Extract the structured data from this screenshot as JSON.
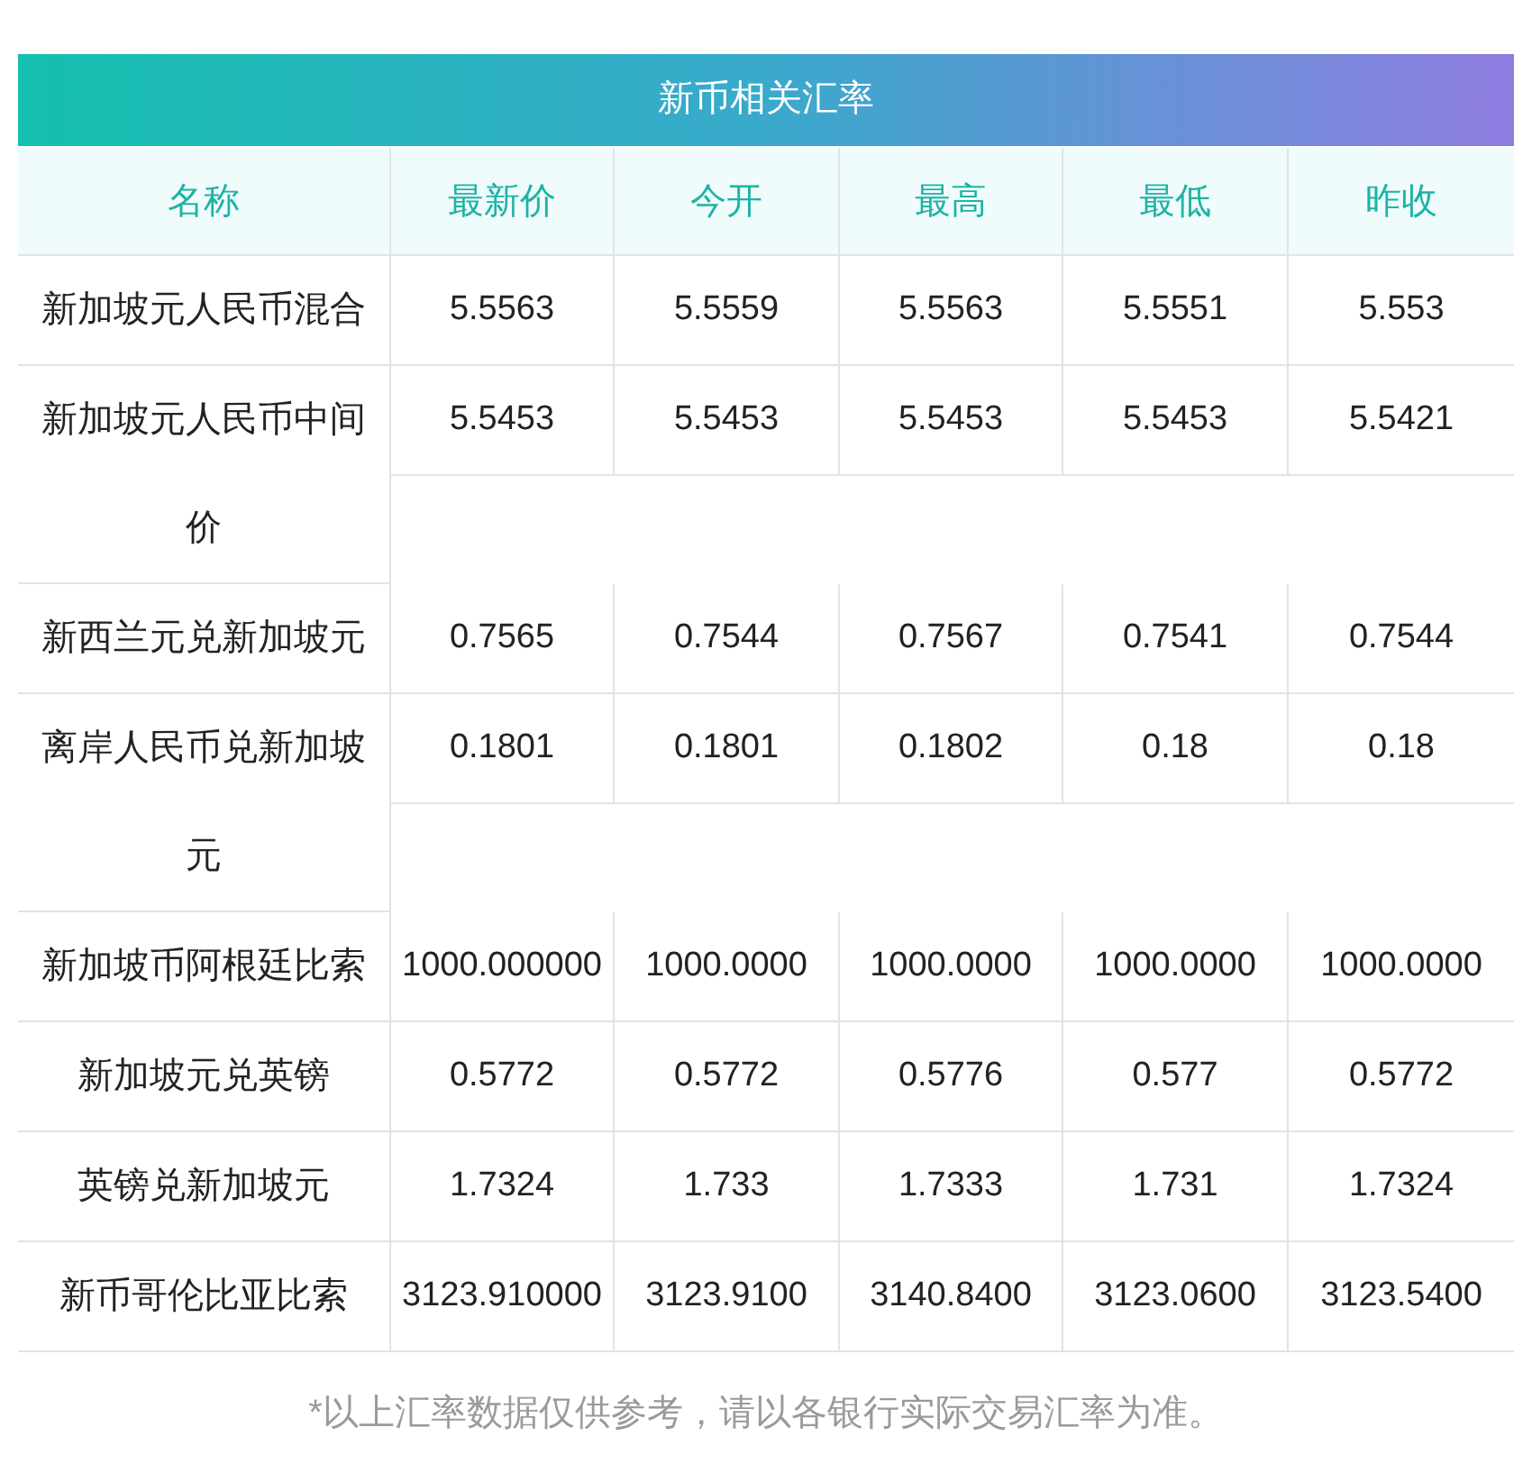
{
  "title": "新币相关汇率",
  "columns": [
    "名称",
    "最新价",
    "今开",
    "最高",
    "最低",
    "昨收"
  ],
  "rows": [
    {
      "name": "新加坡元人民币混合",
      "values": [
        "5.5563",
        "5.5559",
        "5.5563",
        "5.5551",
        "5.553"
      ]
    },
    {
      "name": "新加坡元人民币中间价",
      "values": [
        "5.5453",
        "5.5453",
        "5.5453",
        "5.5453",
        "5.5421"
      ]
    },
    {
      "name": "新西兰元兑新加坡元",
      "values": [
        "0.7565",
        "0.7544",
        "0.7567",
        "0.7541",
        "0.7544"
      ]
    },
    {
      "name": "离岸人民币兑新加坡元",
      "values": [
        "0.1801",
        "0.1801",
        "0.1802",
        "0.18",
        "0.18"
      ]
    },
    {
      "name": "新加坡币阿根廷比索",
      "values": [
        "1000.000000",
        "1000.0000",
        "1000.0000",
        "1000.0000",
        "1000.0000"
      ]
    },
    {
      "name": "新加坡元兑英镑",
      "values": [
        "0.5772",
        "0.5772",
        "0.5776",
        "0.577",
        "0.5772"
      ]
    },
    {
      "name": "英镑兑新加坡元",
      "values": [
        "1.7324",
        "1.733",
        "1.7333",
        "1.731",
        "1.7324"
      ]
    },
    {
      "name": "新币哥伦比亚比索",
      "values": [
        "3123.910000",
        "3123.9100",
        "3140.8400",
        "3123.0600",
        "3123.5400"
      ]
    }
  ],
  "note": "*以上汇率数据仅供参考，请以各银行实际交易汇率为准。"
}
